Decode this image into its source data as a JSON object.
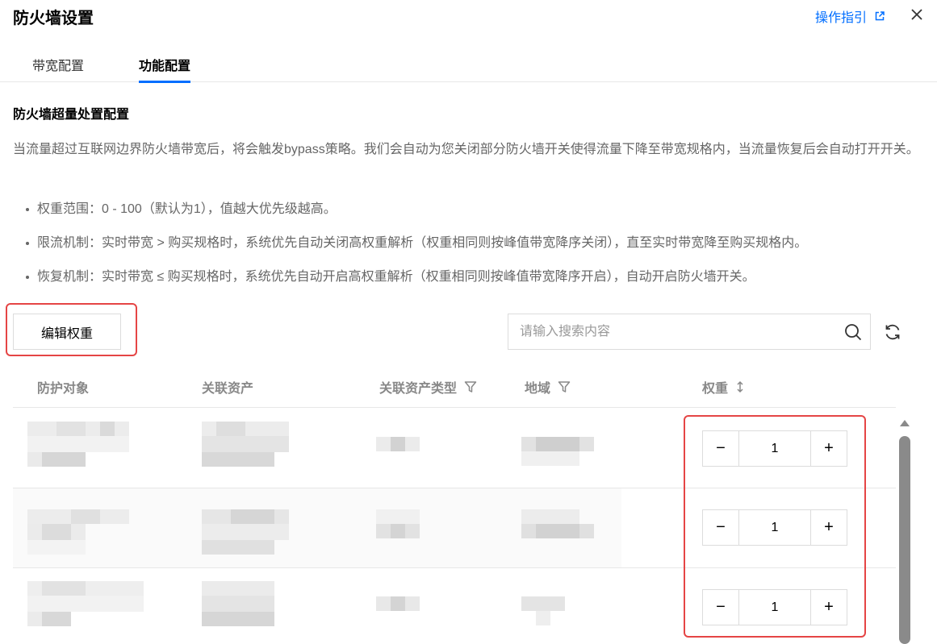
{
  "window": {
    "title": "防火墙设置",
    "guide_label": "操作指引",
    "guide_icon": "external-link-icon",
    "close_icon": "close-icon",
    "accent_color": "#006eff",
    "highlight_color": "#e54545"
  },
  "tabs": [
    {
      "label": "带宽配置",
      "active": false
    },
    {
      "label": "功能配置",
      "active": true
    }
  ],
  "section": {
    "title": "防火墙超量处置配置",
    "description": "当流量超过互联网边界防火墙带宽后，将会触发bypass策略。我们会自动为您关闭部分防火墙开关使得流量下降至带宽规格内，当流量恢复后会自动打开开关。",
    "bullets": [
      "权重范围：0 - 100（默认为1），值越大优先级越高。",
      "限流机制：实时带宽 > 购买规格时，系统优先自动关闭高权重解析（权重相同则按峰值带宽降序关闭），直至实时带宽降至购买规格内。",
      "恢复机制：实时带宽 ≤ 购买规格时，系统优先自动开启高权重解析（权重相同则按峰值带宽降序开启），自动开启防火墙开关。"
    ]
  },
  "toolbar": {
    "edit_weight_label": "编辑权重",
    "search_placeholder": "请输入搜索内容",
    "search_icon": "search-icon",
    "refresh_icon": "refresh-icon"
  },
  "table": {
    "columns": [
      {
        "label": "防护对象",
        "icon": ""
      },
      {
        "label": "关联资产",
        "icon": ""
      },
      {
        "label": "关联资产类型",
        "icon": "filter-icon"
      },
      {
        "label": "地域",
        "icon": "filter-icon"
      },
      {
        "label": "权重",
        "icon": "sort-icon"
      }
    ],
    "rows": [
      {
        "weight": "1"
      },
      {
        "weight": "1"
      },
      {
        "weight": "1"
      }
    ],
    "stepper_minus": "−",
    "stepper_plus": "+"
  }
}
